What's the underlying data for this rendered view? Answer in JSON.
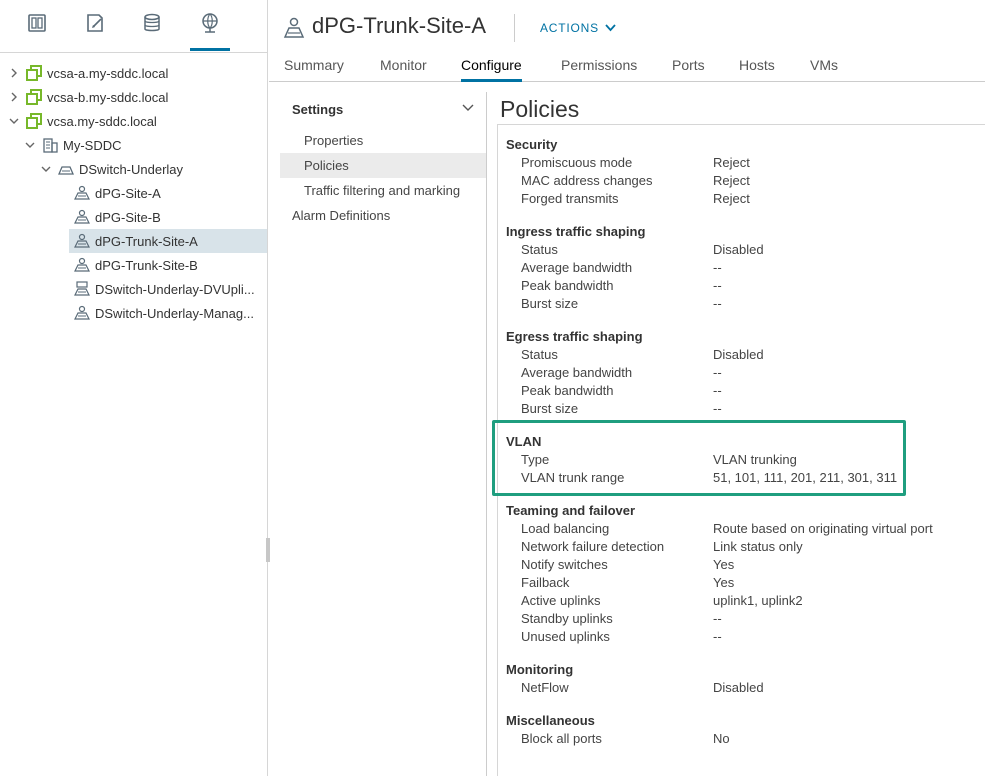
{
  "navigator": {
    "tabs": [
      {
        "icon": "hosts-clusters-icon"
      },
      {
        "icon": "vms-templates-icon"
      },
      {
        "icon": "storage-icon"
      },
      {
        "icon": "networking-icon",
        "active": true
      }
    ],
    "tree": [
      {
        "label": "vcsa-a.my-sddc.local",
        "icon": "vcenter-icon",
        "expanded": false
      },
      {
        "label": "vcsa-b.my-sddc.local",
        "icon": "vcenter-icon",
        "expanded": false
      },
      {
        "label": "vcsa.my-sddc.local",
        "icon": "vcenter-icon",
        "expanded": true
      },
      {
        "label": "My-SDDC",
        "icon": "datacenter-icon",
        "expanded": true
      },
      {
        "label": "DSwitch-Underlay",
        "icon": "distributed-switch-icon",
        "expanded": true
      },
      {
        "label": "dPG-Site-A",
        "icon": "portgroup-icon"
      },
      {
        "label": "dPG-Site-B",
        "icon": "portgroup-icon"
      },
      {
        "label": "dPG-Trunk-Site-A",
        "icon": "portgroup-icon",
        "selected": true
      },
      {
        "label": "dPG-Trunk-Site-B",
        "icon": "portgroup-icon"
      },
      {
        "label": "DSwitch-Underlay-DVUpli...",
        "icon": "uplink-portgroup-icon"
      },
      {
        "label": "DSwitch-Underlay-Manag...",
        "icon": "portgroup-icon"
      }
    ]
  },
  "header": {
    "title": "dPG-Trunk-Site-A",
    "actions_label": "ACTIONS",
    "tabs": [
      "Summary",
      "Monitor",
      "Configure",
      "Permissions",
      "Ports",
      "Hosts",
      "VMs"
    ],
    "active_tab": "Configure"
  },
  "settings": {
    "header": "Settings",
    "items": [
      "Properties",
      "Policies",
      "Traffic filtering and marking"
    ],
    "active_item": "Policies",
    "alarm_definitions": "Alarm Definitions"
  },
  "policies": {
    "title": "Policies",
    "sections": [
      {
        "title": "Security",
        "rows": [
          {
            "label": "Promiscuous mode",
            "value": "Reject"
          },
          {
            "label": "MAC address changes",
            "value": "Reject"
          },
          {
            "label": "Forged transmits",
            "value": "Reject"
          }
        ]
      },
      {
        "title": "Ingress traffic shaping",
        "rows": [
          {
            "label": "Status",
            "value": "Disabled"
          },
          {
            "label": "Average bandwidth",
            "value": "--"
          },
          {
            "label": "Peak bandwidth",
            "value": "--"
          },
          {
            "label": "Burst size",
            "value": "--"
          }
        ]
      },
      {
        "title": "Egress traffic shaping",
        "rows": [
          {
            "label": "Status",
            "value": "Disabled"
          },
          {
            "label": "Average bandwidth",
            "value": "--"
          },
          {
            "label": "Peak bandwidth",
            "value": "--"
          },
          {
            "label": "Burst size",
            "value": "--"
          }
        ]
      },
      {
        "title": "VLAN",
        "rows": [
          {
            "label": "Type",
            "value": "VLAN trunking"
          },
          {
            "label": "VLAN trunk range",
            "value": "51, 101, 111, 201, 211, 301, 311"
          }
        ]
      },
      {
        "title": "Teaming and failover",
        "rows": [
          {
            "label": "Load balancing",
            "value": "Route based on originating virtual port"
          },
          {
            "label": "Network failure detection",
            "value": "Link status only"
          },
          {
            "label": "Notify switches",
            "value": "Yes"
          },
          {
            "label": "Failback",
            "value": "Yes"
          },
          {
            "label": "Active uplinks",
            "value": "uplink1, uplink2"
          },
          {
            "label": "Standby uplinks",
            "value": "--"
          },
          {
            "label": "Unused uplinks",
            "value": "--"
          }
        ]
      },
      {
        "title": "Monitoring",
        "rows": [
          {
            "label": "NetFlow",
            "value": "Disabled"
          }
        ]
      },
      {
        "title": "Miscellaneous",
        "rows": [
          {
            "label": "Block all ports",
            "value": "No"
          }
        ]
      }
    ]
  },
  "colors": {
    "accent": "#0072a3",
    "highlight": "#1f9e7f",
    "selected_row": "#d8e3e9",
    "vcenter_icon": "#77b82a"
  }
}
